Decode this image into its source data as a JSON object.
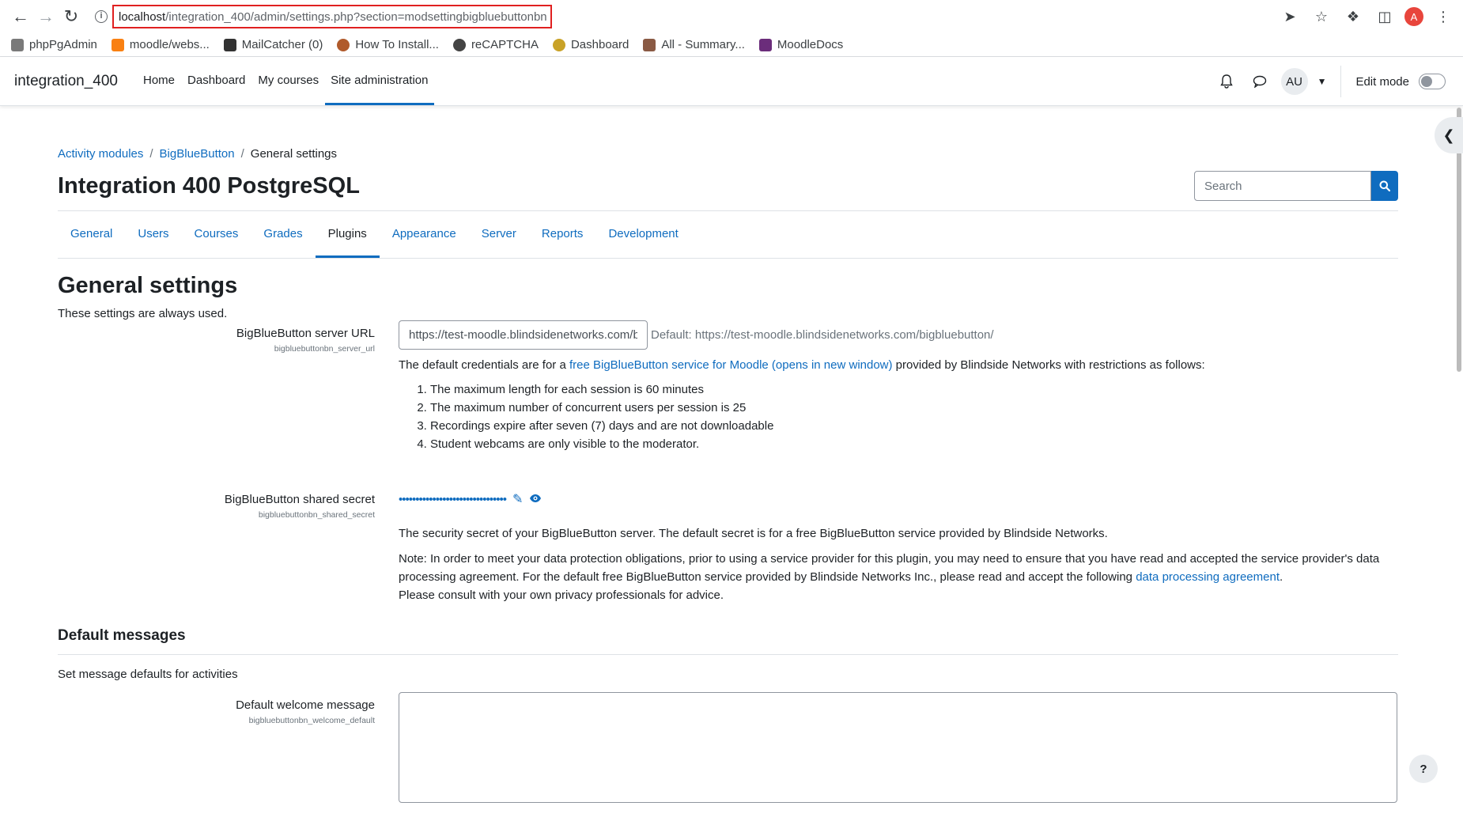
{
  "browser": {
    "url_host": "localhost",
    "url_path": "/integration_400/admin/settings.php?section=modsettingbigbluebuttonbn",
    "profile_initial": "A",
    "bookmarks": [
      {
        "label": "phpPgAdmin",
        "color": "#7a7a7a"
      },
      {
        "label": "moodle/webs...",
        "color": "#f98012"
      },
      {
        "label": "MailCatcher (0)",
        "color": "#333333"
      },
      {
        "label": "How To Install...",
        "color": "#b05a2b"
      },
      {
        "label": "reCAPTCHA",
        "color": "#444444"
      },
      {
        "label": "Dashboard",
        "color": "#c9a227"
      },
      {
        "label": "All - Summary...",
        "color": "#8a5a44"
      },
      {
        "label": "MoodleDocs",
        "color": "#6b2d7b"
      }
    ]
  },
  "navbar": {
    "site_name": "integration_400",
    "items": [
      {
        "label": "Home"
      },
      {
        "label": "Dashboard"
      },
      {
        "label": "My courses"
      },
      {
        "label": "Site administration"
      }
    ],
    "user_initials": "AU",
    "edit_mode_label": "Edit mode"
  },
  "breadcrumb": {
    "items": [
      "Activity modules",
      "BigBlueButton",
      "General settings"
    ]
  },
  "page": {
    "title": "Integration 400 PostgreSQL",
    "search_placeholder": "Search"
  },
  "tabs": [
    "General",
    "Users",
    "Courses",
    "Grades",
    "Plugins",
    "Appearance",
    "Server",
    "Reports",
    "Development"
  ],
  "section": {
    "heading": "General settings",
    "intro": "These settings are always used."
  },
  "server_url": {
    "label": "BigBlueButton server URL",
    "key": "bigbluebuttonbn_server_url",
    "value": "https://test-moodle.blindsidenetworks.com/bigbluebutton/",
    "default_text": "Default: https://test-moodle.blindsidenetworks.com/bigbluebutton/",
    "desc_prefix": "The default credentials are for a ",
    "desc_link": "free BigBlueButton service for Moodle (opens in new window)",
    "desc_suffix": " provided by Blindside Networks with restrictions as follows:",
    "restrictions": [
      "The maximum length for each session is 60 minutes",
      "The maximum number of concurrent users per session is 25",
      "Recordings expire after seven (7) days and are not downloadable",
      "Student webcams are only visible to the moderator."
    ]
  },
  "shared_secret": {
    "label": "BigBlueButton shared secret",
    "key": "bigbluebuttonbn_shared_secret",
    "masked": "••••••••••••••••••••••••••••••••",
    "desc": "The security secret of your BigBlueButton server. The default secret is for a free BigBlueButton service provided by Blindside Networks.",
    "note_prefix": "Note: In order to meet your data protection obligations, prior to using a service provider for this plugin, you may need to ensure that you have read and accepted the service provider's data processing agreement. For the default free BigBlueButton service provided by Blindside Networks Inc., please read and accept the following ",
    "note_link": "data processing agreement",
    "note_suffix": ".",
    "note_line2": "Please consult with your own privacy professionals for advice."
  },
  "default_messages": {
    "heading": "Default messages",
    "intro": "Set message defaults for activities",
    "welcome_label": "Default welcome message",
    "welcome_key": "bigbluebuttonbn_welcome_default"
  },
  "help_label": "?"
}
